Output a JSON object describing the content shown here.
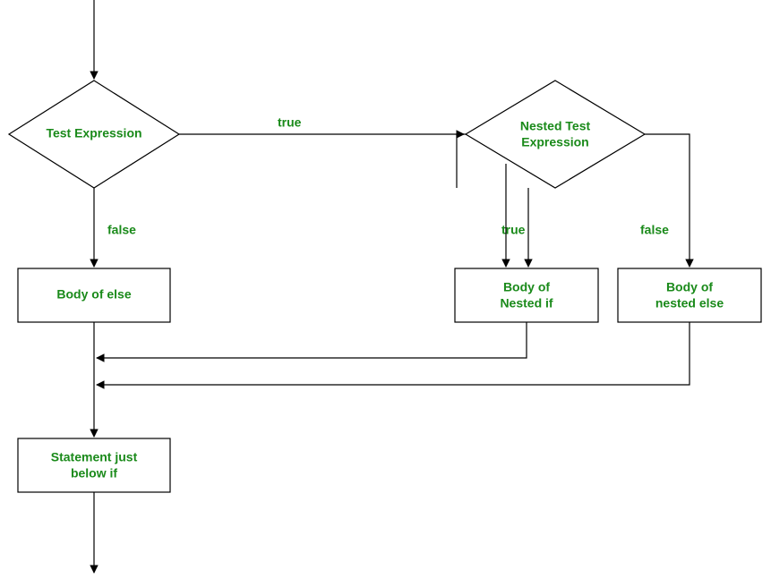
{
  "diagram": {
    "type": "flowchart",
    "nodes": {
      "test_expression": {
        "label": "Test Expression",
        "shape": "decision"
      },
      "nested_test_expression": {
        "label_l1": "Nested Test",
        "label_l2": "Expression",
        "shape": "decision"
      },
      "body_else": {
        "label": "Body of else",
        "shape": "process"
      },
      "body_nested_if": {
        "label_l1": "Body of",
        "label_l2": "Nested if",
        "shape": "process"
      },
      "body_nested_else": {
        "label_l1": "Body of",
        "label_l2": "nested else",
        "shape": "process"
      },
      "statement_below_if": {
        "label_l1": "Statement just",
        "label_l2": "below if",
        "shape": "process"
      }
    },
    "edges": {
      "test_true": {
        "label": "true"
      },
      "test_false": {
        "label": "false"
      },
      "nested_true": {
        "label": "true"
      },
      "nested_false": {
        "label": "false"
      }
    }
  }
}
